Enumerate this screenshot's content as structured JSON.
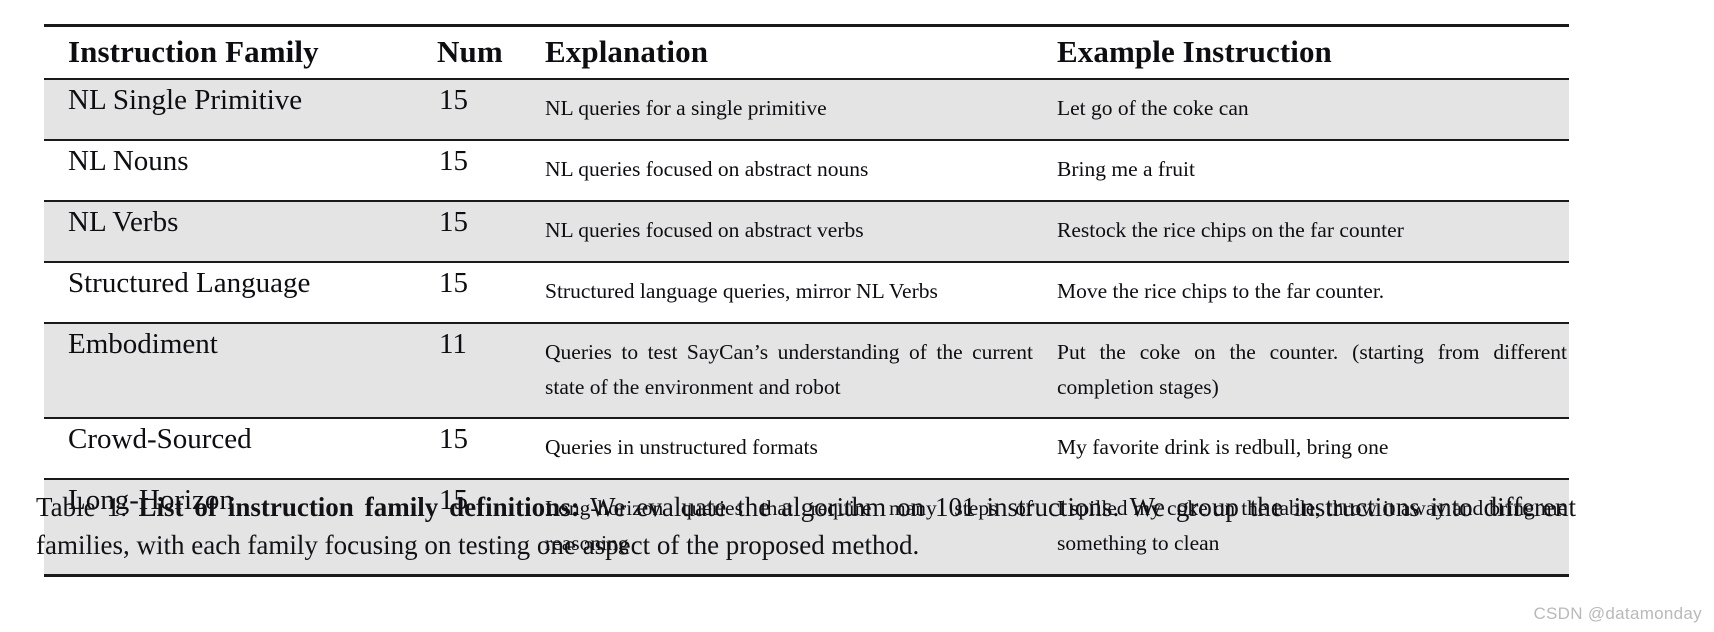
{
  "document": {
    "type": "paper-table-figure",
    "background_color": "#ffffff",
    "rule_color": "#1a1a1a",
    "shaded_row_color": "#e4e4e4",
    "text_color": "#0d0d12"
  },
  "table": {
    "columns": [
      {
        "key": "family",
        "header": "Instruction Family"
      },
      {
        "key": "num",
        "header": "Num"
      },
      {
        "key": "explanation",
        "header": "Explanation"
      },
      {
        "key": "example",
        "header": "Example Instruction"
      }
    ],
    "rows": [
      {
        "family": "NL Single Primitive",
        "num": "15",
        "explanation": "NL queries for a single primitive",
        "example": "Let go of the coke can",
        "shaded": true,
        "multiline": false
      },
      {
        "family": "NL Nouns",
        "num": "15",
        "explanation": "NL queries focused on abstract nouns",
        "example": "Bring me a fruit",
        "shaded": false,
        "multiline": false
      },
      {
        "family": "NL Verbs",
        "num": "15",
        "explanation": "NL queries focused on abstract verbs",
        "example": "Restock the rice chips on the far counter",
        "shaded": true,
        "multiline": false
      },
      {
        "family": "Structured Language",
        "num": "15",
        "explanation": "Structured language queries, mirror NL Verbs",
        "example": "Move the rice chips to the far counter.",
        "shaded": false,
        "multiline": false
      },
      {
        "family": "Embodiment",
        "num": "11",
        "explanation": "Queries to test SayCan’s understanding of the current state of the environment and robot",
        "example": "Put the coke on the counter.  (starting from different completion stages)",
        "shaded": true,
        "multiline": true
      },
      {
        "family": "Crowd-Sourced",
        "num": "15",
        "explanation": "Queries in unstructured formats",
        "example": "My favorite drink is redbull, bring one",
        "shaded": false,
        "multiline": false
      },
      {
        "family": "Long-Horizon",
        "num": "15",
        "explanation": "Long-horizon queries that require many steps of reasoning",
        "example": "I spilled my coke on the table, throw it away and bring me something to clean",
        "shaded": true,
        "multiline": true
      }
    ]
  },
  "caption": {
    "label": "Table 1: ",
    "bold_title": "List of instruction family definitions:",
    "body": " We evaluate the algorithm on 101 instructions. We group the instructions into different families, with each family focusing on testing one aspect of the proposed method."
  },
  "watermark": {
    "text": "CSDN @datamonday"
  }
}
